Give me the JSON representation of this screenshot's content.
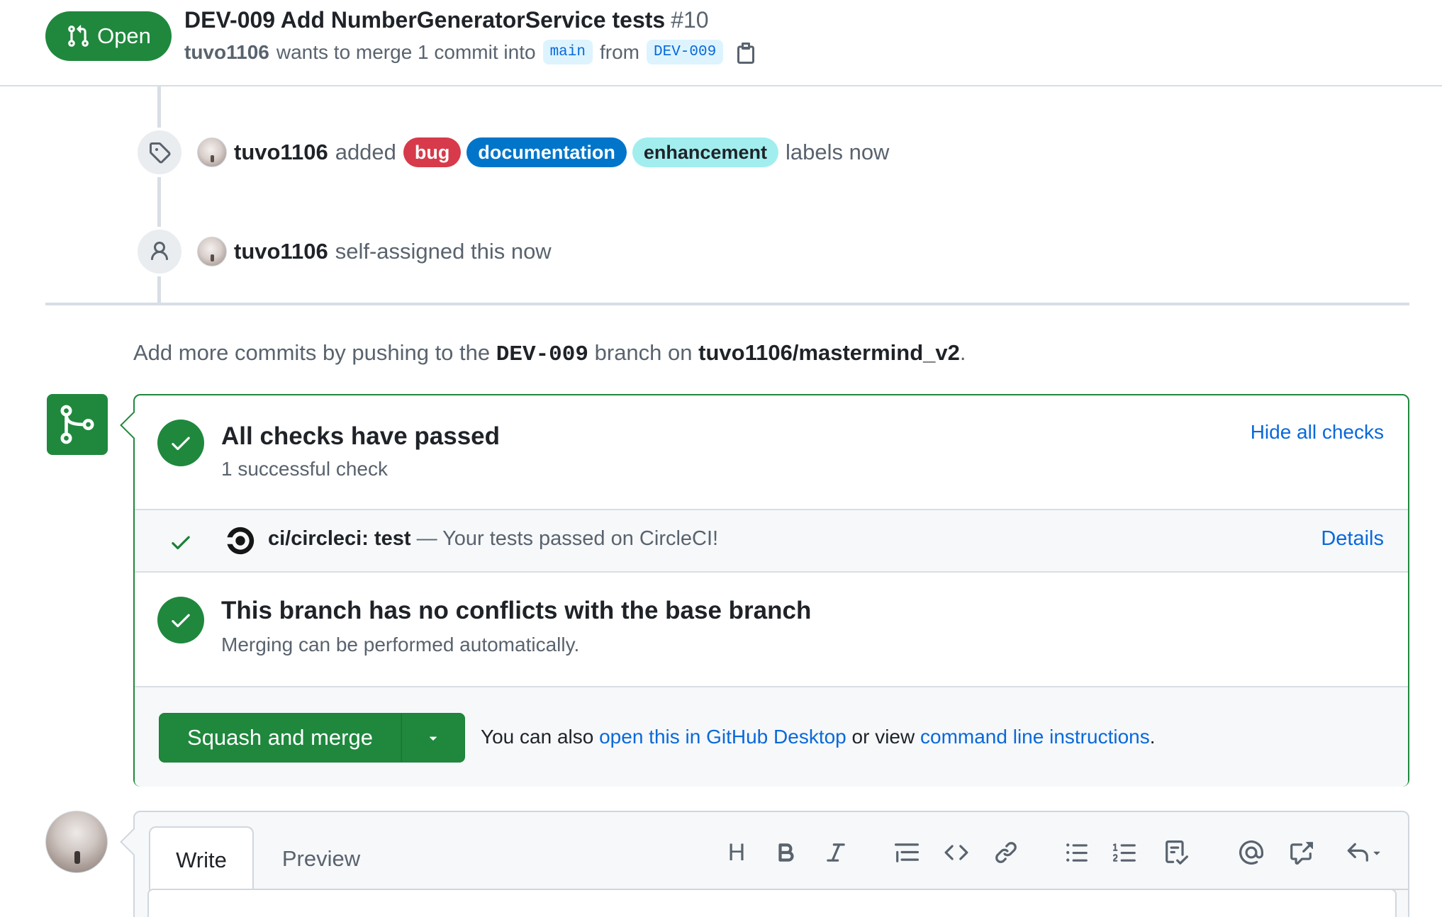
{
  "header": {
    "state": "Open",
    "title": "DEV-009 Add NumberGeneratorService tests",
    "number": "#10",
    "author": "tuvo1106",
    "merge_text": "wants to merge 1 commit into",
    "base_branch": "main",
    "from_text": "from",
    "head_branch": "DEV-009"
  },
  "timeline": {
    "labels_event": {
      "actor": "tuvo1106",
      "verb": "added",
      "labels": [
        {
          "name": "bug",
          "color": "#d73a4a"
        },
        {
          "name": "documentation",
          "color": "#0075ca"
        },
        {
          "name": "enhancement",
          "color": "#a2eeef"
        }
      ],
      "suffix": "labels now"
    },
    "assign_event": {
      "actor": "tuvo1106",
      "text": "self-assigned this now"
    }
  },
  "push_hint": {
    "prefix": "Add more commits by pushing to the",
    "branch": "DEV-009",
    "middle": "branch on",
    "repo": "tuvo1106/mastermind_v2",
    "suffix": "."
  },
  "merge_box": {
    "checks_title": "All checks have passed",
    "checks_subtitle": "1 successful check",
    "hide_checks": "Hide all checks",
    "check": {
      "name": "ci/circleci: test",
      "description": "— Your tests passed on CircleCI!",
      "details": "Details"
    },
    "conflicts_title": "This branch has no conflicts with the base branch",
    "conflicts_subtitle": "Merging can be performed automatically.",
    "merge_button": "Squash and merge",
    "also_text": "You can also",
    "desktop_link": "open this in GitHub Desktop",
    "or_view": "or view",
    "cli_link": "command line instructions",
    "period": "."
  },
  "composer": {
    "tabs": [
      "Write",
      "Preview"
    ],
    "toolbar_heading": "H"
  },
  "colors": {
    "success": "#1f883d",
    "link": "#0969da",
    "muted": "#59636e"
  }
}
